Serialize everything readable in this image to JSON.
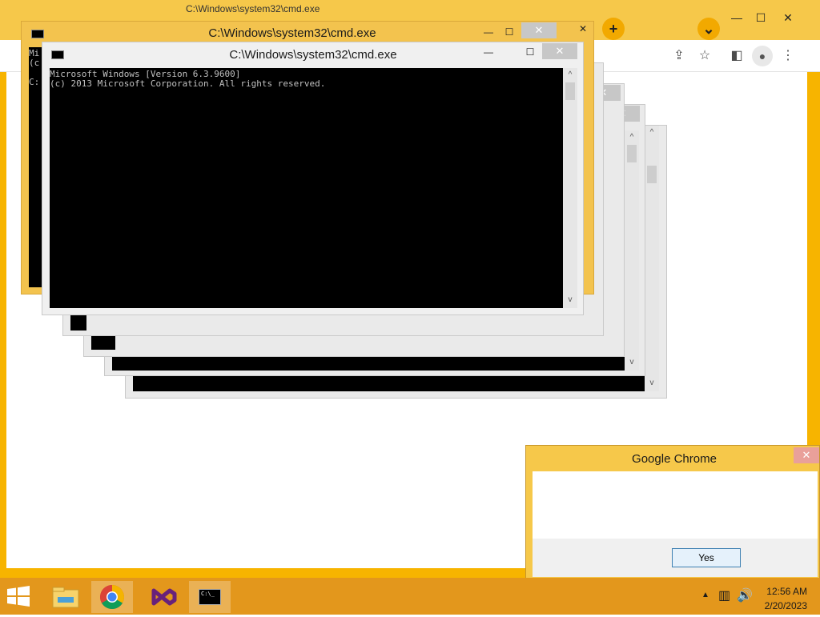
{
  "chrome": {
    "tab_titles": [
      "C:\\Windows\\system32\\cmd.exe",
      "C:\\Windows\\system32\\cmd.exe"
    ],
    "new_tab_label": "+",
    "tab_search_label": "⌄",
    "caption": {
      "minimize": "—",
      "maximize": "☐",
      "close": "✕"
    },
    "toolbar_icons": [
      "share-icon",
      "bookmark-star-icon",
      "side-panel-icon",
      "profile-icon",
      "menu-icon"
    ]
  },
  "cmd_windows": [
    {
      "title": "C:\\Windows\\system32\\cmd.exe",
      "lines": [
        "Mi",
        "(c",
        "",
        "C:"
      ]
    },
    {
      "title": "C:\\Windows\\system32\\cmd.exe",
      "lines": [
        "Microsoft Windows [Version 6.3.9600]",
        "(c) 2013 Microsoft Corporation. All rights reserved."
      ]
    }
  ],
  "window_buttons": {
    "minimize": "—",
    "maximize": "☐",
    "close": "✕"
  },
  "dialog": {
    "title": "Google Chrome",
    "close": "✕",
    "yes_label": "Yes"
  },
  "taskbar": {
    "items": [
      "file-explorer-icon",
      "chrome-icon",
      "visual-studio-icon",
      "command-prompt-icon"
    ],
    "cmd_icon_text": "C:\\_",
    "time": "12:56 AM",
    "date": "2/20/2023",
    "tray_icons": [
      "show-hidden-icons-icon",
      "network-icon",
      "volume-icon"
    ]
  },
  "colors": {
    "accent": "#f6c84a",
    "taskbar": "#e3971c",
    "console": "#000000"
  }
}
